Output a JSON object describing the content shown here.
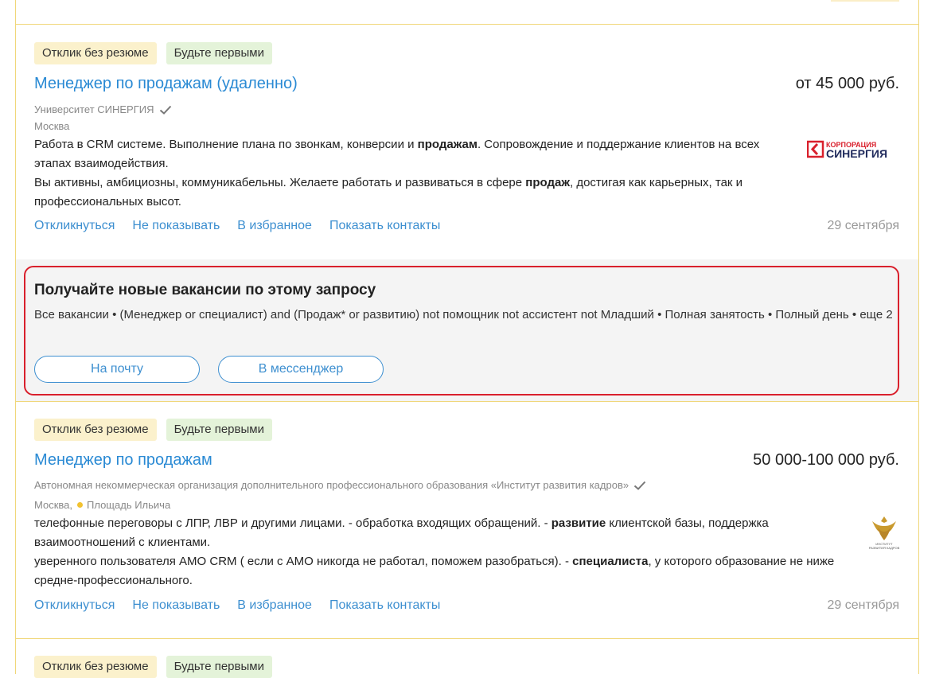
{
  "vacancies": [
    {
      "tags": [
        "Отклик без резюме",
        "Будьте первыми"
      ],
      "title": "Менеджер по продажам (удаленно)",
      "salary": "от 45 000 руб.",
      "company": "Университет СИНЕРГИЯ",
      "city": "Москва",
      "metro": "",
      "desc1": [
        {
          "text": "Работа в CRM системе. Выполнение плана по звонкам, конверсии и ",
          "bold": false
        },
        {
          "text": "продажам",
          "bold": true
        },
        {
          "text": ". Сопровождение и поддержание клиентов на всех этапах взаимодействия.",
          "bold": false
        }
      ],
      "desc2": [
        {
          "text": "Вы активны, амбициозны, коммуникабельны. Желаете работать и развиваться в сфере ",
          "bold": false
        },
        {
          "text": "продаж",
          "bold": true
        },
        {
          "text": ", достигая как карьерных, так и профессиональных высот.",
          "bold": false
        }
      ],
      "logo_text": [
        "КОРПОРАЦИЯ",
        "СИНЕРГИЯ"
      ],
      "actions": [
        "Откликнуться",
        "Не показывать",
        "В избранное",
        "Показать контакты"
      ],
      "date": "29 сентября"
    },
    {
      "tags": [
        "Отклик без резюме",
        "Будьте первыми"
      ],
      "title": "Менеджер по продажам",
      "salary": "50 000-100 000 руб.",
      "company": "Автономная некоммерческая организация дополнительного профессионального образования «Институт развития кадров»",
      "city": "Москва,",
      "metro": "Площадь Ильича",
      "desc1": [
        {
          "text": "телефонные переговоры с ЛПР, ЛВР и другими лицами. - обработка входящих обращений. - ",
          "bold": false
        },
        {
          "text": "развитие",
          "bold": true
        },
        {
          "text": " клиентской базы, поддержка взаимоотношений с клиентами.",
          "bold": false
        }
      ],
      "desc2": [
        {
          "text": "уверенного пользователя АМО CRM ( если с АМО никогда не работал, поможем разобраться). - ",
          "bold": false
        },
        {
          "text": "специалиста",
          "bold": true
        },
        {
          "text": ", у которого образование не ниже средне-профессионального.",
          "bold": false
        }
      ],
      "logo_text": [
        "ИНСТИТУТ",
        "РАЗВИТИЯ КАДРОВ"
      ],
      "actions": [
        "Откликнуться",
        "Не показывать",
        "В избранное",
        "Показать контакты"
      ],
      "date": "29 сентября"
    },
    {
      "tags": [
        "Отклик без резюме",
        "Будьте первыми"
      ]
    }
  ],
  "subscribe": {
    "title": "Получайте новые вакансии по этому запросу",
    "text": "Все вакансии • (Менеджер or специалист) and (Продаж* or развитию) not помощник not ассистент not Младший • Полная занятость • Полный день • еще 2",
    "btn_mail": "На почту",
    "btn_messenger": "В мессенджер"
  },
  "colors": {
    "link": "#2a8ad4",
    "border": "#f0d77a",
    "highlight": "#d9202c",
    "tag_no_resume": "#fbf1cc",
    "tag_first": "#e4f3d9"
  }
}
